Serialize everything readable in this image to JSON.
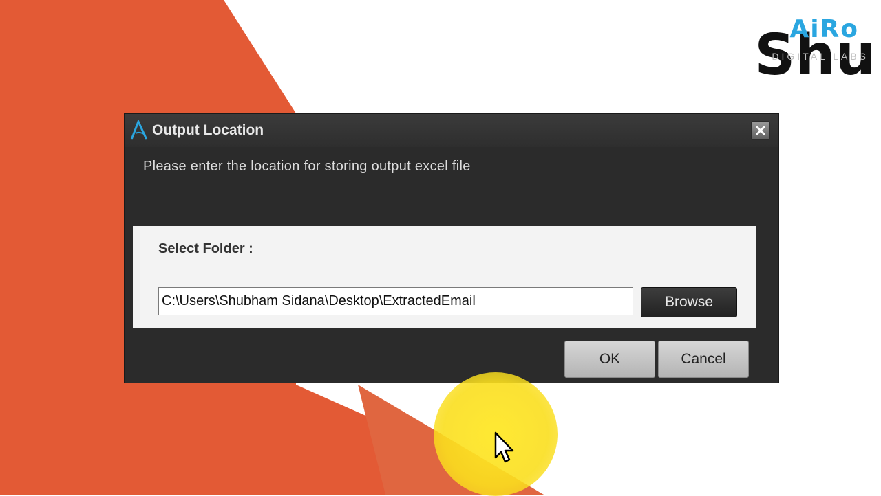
{
  "logo": {
    "brand": "AiRo",
    "subtitle": "DIGITAL LABS",
    "overlay_text": "Shu"
  },
  "dialog": {
    "title": "Output Location",
    "message": "Please enter the location for storing output excel file",
    "folder_label": "Select Folder :",
    "path_value": "C:\\Users\\Shubham Sidana\\Desktop\\ExtractedEmail",
    "browse_label": "Browse",
    "ok_label": "OK",
    "cancel_label": "Cancel"
  },
  "colors": {
    "background_orange": "#e35a35",
    "dialog_bg": "#2b2b2b",
    "panel_bg": "#f3f3f3",
    "brand_blue": "#2aa6e0",
    "cursor_highlight": "#f7dc1e"
  },
  "icons": {
    "app": "airo-logo-icon",
    "close": "close-icon",
    "cursor": "mouse-pointer-icon"
  }
}
